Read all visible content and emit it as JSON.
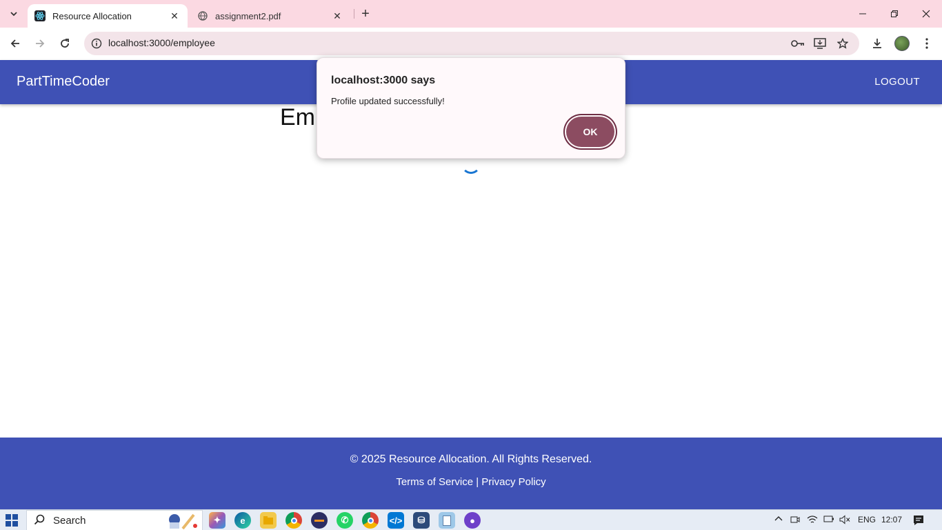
{
  "browser": {
    "tabs": [
      {
        "title": "Resource Allocation",
        "icon": "react-icon",
        "active": true
      },
      {
        "title": "assignment2.pdf",
        "icon": "globe-icon",
        "active": false
      }
    ],
    "address": "localhost:3000/employee"
  },
  "app": {
    "brand": "PartTimeCoder",
    "logout_label": "LOGOUT",
    "heading_visible": "Em",
    "primary_color": "#3f51b5"
  },
  "dialog": {
    "title": "localhost:3000 says",
    "message": "Profile updated successfully!",
    "ok_label": "OK",
    "ok_color": "#8c4c61"
  },
  "footer": {
    "copyright": "© 2025 Resource Allocation. All Rights Reserved.",
    "terms": "Terms of Service",
    "separator": "|",
    "privacy": "Privacy Policy"
  },
  "taskbar": {
    "search_label": "Search",
    "language": "ENG",
    "time": "12:07"
  }
}
